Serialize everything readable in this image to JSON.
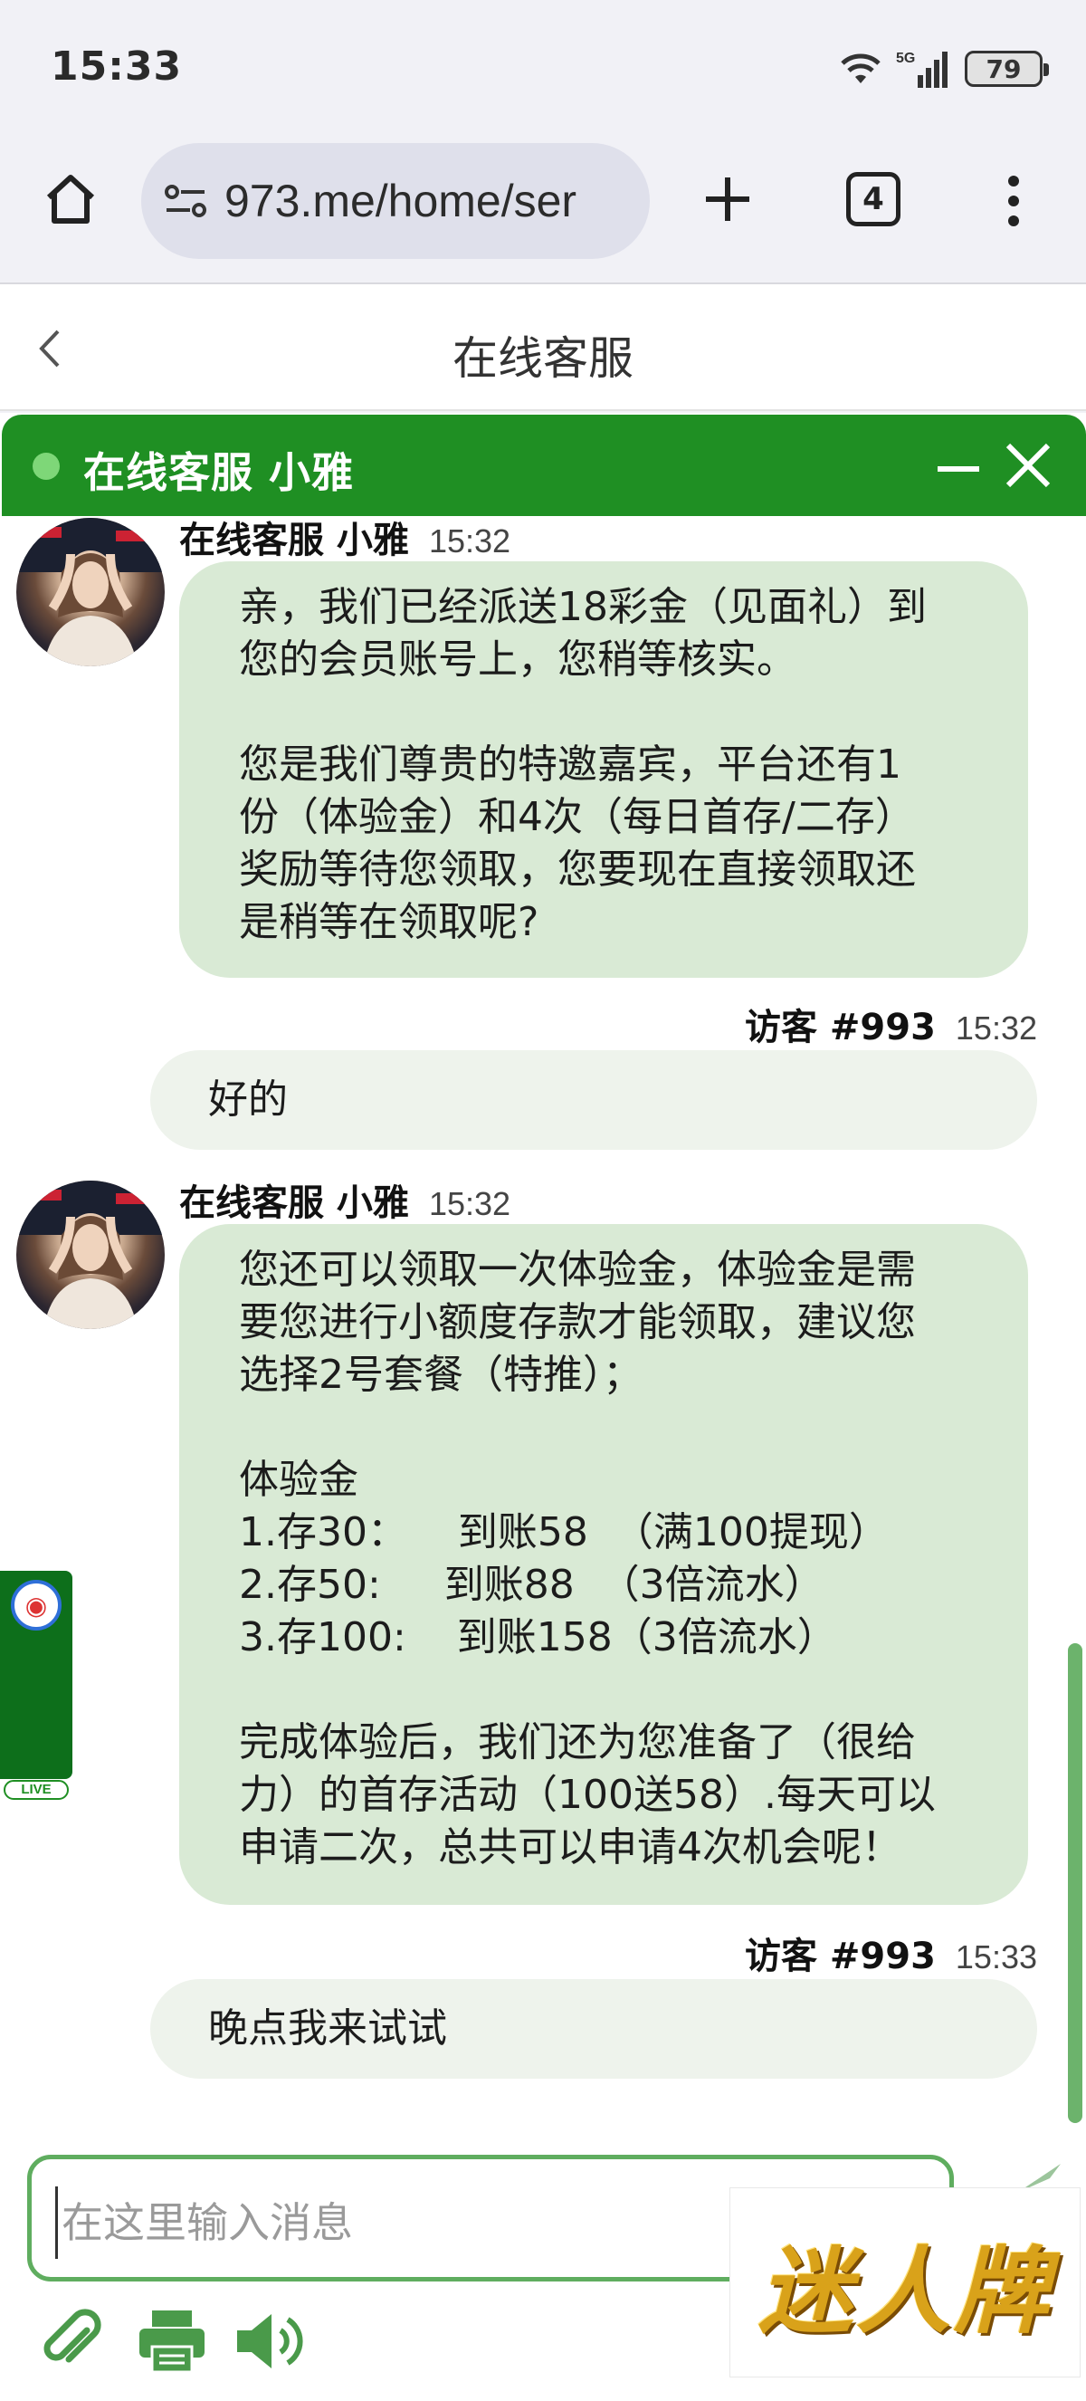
{
  "status_bar": {
    "time": "15:33",
    "network": "5G",
    "battery": "79"
  },
  "browser": {
    "url": "973.me/home/ser",
    "tab_count": "4"
  },
  "page": {
    "title": "在线客服"
  },
  "chat": {
    "header_title": "在线客服 小雅",
    "messages": [
      {
        "sender": "在线客服 小雅",
        "time": "15:32",
        "text": "亲，我们已经派送18彩金（见面礼）到\n您的会员账号上，您稍等核实。\n\n您是我们尊贵的特邀嘉宾，平台还有1\n份（体验金）和4次（每日首存/二存）\n奖励等待您领取，您要现在直接领取还\n是稍等在领取呢?"
      },
      {
        "sender": "访客 #993",
        "time": "15:32",
        "text": "好的"
      },
      {
        "sender": "在线客服 小雅",
        "time": "15:32",
        "text": "您还可以领取一次体验金，体验金是需\n要您进行小额度存款才能领取，建议您\n选择2号套餐（特推）；\n\n体验金\n1.存30：    到账58  （满100提现）\n2.存50:     到账88  （3倍流水）\n3.存100:    到账158（3倍流水）\n\n完成体验后，我们还为您准备了（很给\n力）的首存活动（100送58）.每天可以\n申请二次，总共可以申请4次机会呢！"
      },
      {
        "sender": "访客 #993",
        "time": "15:33",
        "text": "晚点我来试试"
      }
    ],
    "input_placeholder": "在这里输入消息",
    "scroll_position": 0.82
  },
  "live_widget": {
    "badge": "LIVE"
  },
  "brand": {
    "text": "迷人牌"
  },
  "colors": {
    "header_green": "#1f8f23",
    "agent_bubble": "#d9ead5",
    "visitor_bubble": "#eef3ec",
    "input_border": "#5fad5f"
  }
}
